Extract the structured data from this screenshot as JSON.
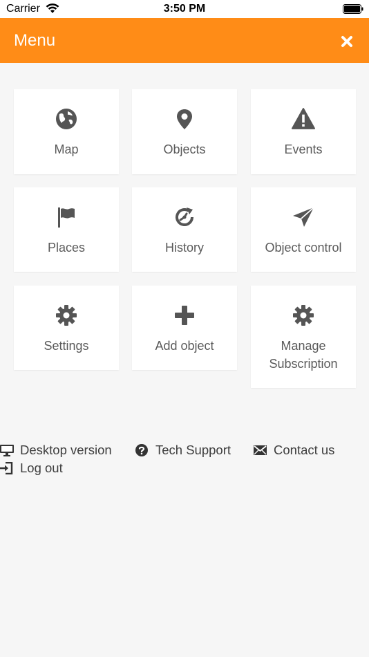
{
  "status_bar": {
    "carrier": "Carrier",
    "time": "3:50 PM"
  },
  "header": {
    "title": "Menu"
  },
  "tiles": [
    {
      "label": "Map",
      "icon": "globe-icon"
    },
    {
      "label": "Objects",
      "icon": "map-pin-icon"
    },
    {
      "label": "Events",
      "icon": "warning-icon"
    },
    {
      "label": "Places",
      "icon": "flag-icon"
    },
    {
      "label": "History",
      "icon": "history-icon"
    },
    {
      "label": "Object control",
      "icon": "send-icon"
    },
    {
      "label": "Settings",
      "icon": "gear-icon"
    },
    {
      "label": "Add object",
      "icon": "plus-icon"
    },
    {
      "label": "Manage Subscription",
      "icon": "gear-icon"
    }
  ],
  "footer_links": {
    "desktop": "Desktop version",
    "support": "Tech Support",
    "contact": "Contact us",
    "logout": "Log out"
  },
  "colors": {
    "accent": "#ff8c17",
    "icon": "#555555",
    "background": "#f6f6f6"
  }
}
